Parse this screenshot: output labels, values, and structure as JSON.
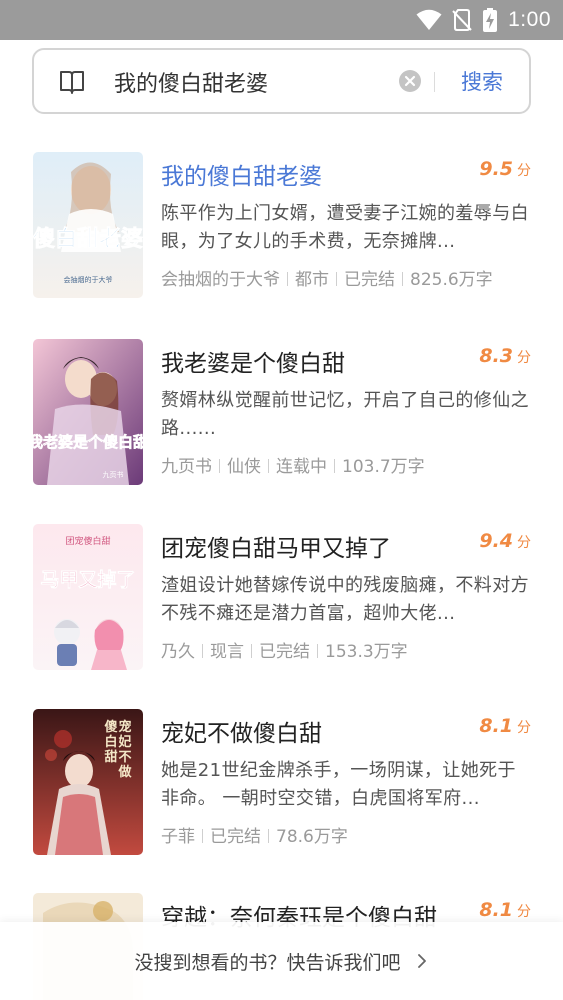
{
  "status_bar": {
    "time": "1:00"
  },
  "search": {
    "query": "我的傻白甜老婆",
    "button_label": "搜索"
  },
  "results": [
    {
      "title": "我的傻白甜老婆",
      "score": "9.5",
      "unit": "分",
      "description": "陈平作为上门女婿，遭受妻子江婉的羞辱与白眼，为了女儿的手术费，无奈摊牌...",
      "meta": [
        "会抽烟的于大爷",
        "都市",
        "已完结",
        "825.6万字"
      ],
      "cover_title": "傻白甜老婆",
      "cover_small": "会抽烟的于大爷",
      "cover_colors": [
        "#dfeef8",
        "#f6f1ec"
      ]
    },
    {
      "title": "我老婆是个傻白甜",
      "score": "8.3",
      "unit": "分",
      "description": "赘婿林纵觉醒前世记忆，开启了自己的修仙之路......",
      "meta": [
        "九页书",
        "仙侠",
        "连载中",
        "103.7万字"
      ],
      "cover_title": "我老婆是个傻白甜",
      "cover_small": "九页书",
      "cover_colors": [
        "#f3c6d6",
        "#6b3a78"
      ]
    },
    {
      "title": "团宠傻白甜马甲又掉了",
      "score": "9.4",
      "unit": "分",
      "description": "渣姐设计她替嫁传说中的残废脑瘫，不料对方不残不瘫还是潜力首富，超帅大佬...",
      "meta": [
        "乃久",
        "现言",
        "已完结",
        "153.3万字"
      ],
      "cover_title": "马甲又掉了",
      "cover_small": "团宠傻白甜",
      "cover_colors": [
        "#fde8ee",
        "#fbf4f6"
      ]
    },
    {
      "title": "宠妃不做傻白甜",
      "score": "8.1",
      "unit": "分",
      "description": "她是21世纪金牌杀手，一场阴谋，让她死于非命。 一朝时空交错，白虎国将军府...",
      "meta": [
        "子菲",
        "已完结",
        "78.6万字"
      ],
      "cover_title": "宠妃不做傻白甜",
      "cover_small": "",
      "cover_colors": [
        "#3a1616",
        "#c24a3f"
      ]
    },
    {
      "title": "穿越：奈何秦珏是个傻白甜",
      "score": "8.1",
      "unit": "分",
      "description": "",
      "meta": [],
      "cover_title": "",
      "cover_small": "",
      "cover_colors": [
        "#f4ead9",
        "#e7d3b0"
      ]
    }
  ],
  "footer": {
    "text": "没搜到想看的书？快告诉我们吧"
  },
  "colors": {
    "accent": "#4a78d6",
    "rating": "#f08a43",
    "status_bar": "#9b9b9b"
  },
  "icons": [
    "wifi-icon",
    "no-sim-icon",
    "battery-charging-icon",
    "book-icon",
    "clear-icon",
    "chevron-right-icon"
  ]
}
